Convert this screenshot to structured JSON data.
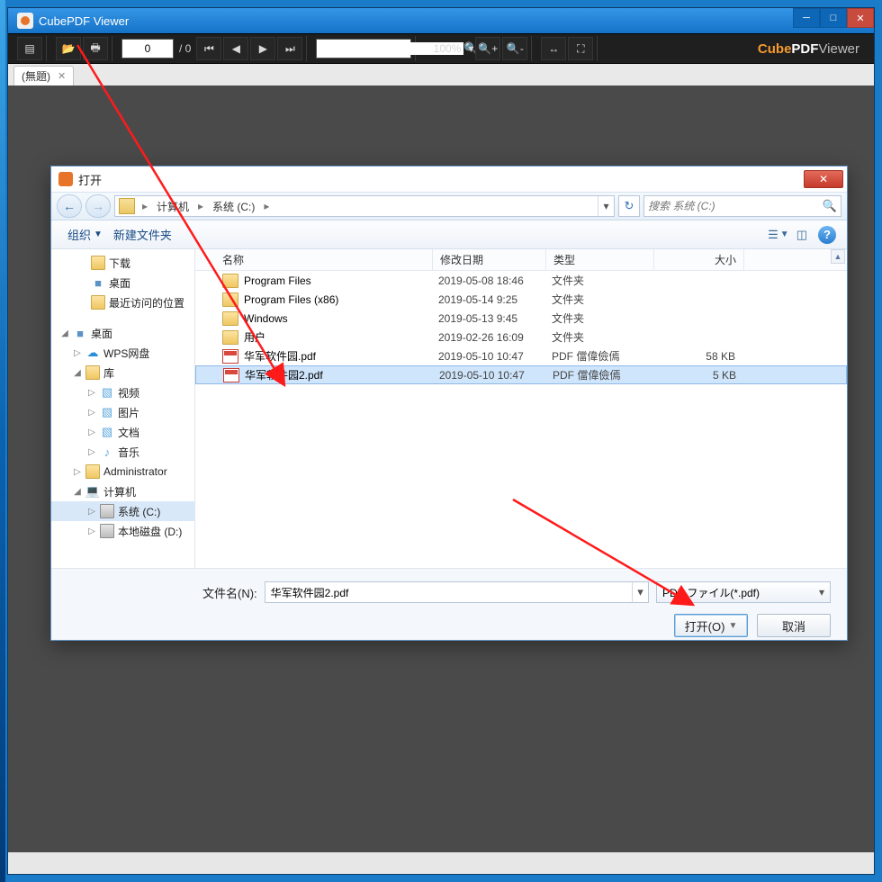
{
  "app": {
    "title": "CubePDF Viewer",
    "brand_parts": {
      "a": "Cube",
      "b": "PDF",
      "c": "Viewer"
    }
  },
  "toolbar": {
    "page_current": "0",
    "page_total": "/ 0",
    "zoom": "100%",
    "zoom_dd": "▾"
  },
  "tabs": {
    "untitled": "(無題)"
  },
  "dialog": {
    "title": "打开",
    "breadcrumb": {
      "seg1": "计算机",
      "seg2": "系统 (C:)"
    },
    "search_placeholder": "搜索 系统 (C:)",
    "toolbar": {
      "organize": "组织",
      "newfolder": "新建文件夹"
    },
    "headers": {
      "name": "名称",
      "date": "修改日期",
      "type": "类型",
      "size": "大小"
    },
    "filename_label": "文件名(N):",
    "filename_value": "华军软件园2.pdf",
    "filter": "PDF ファイル(*.pdf)",
    "open_btn": "打开(O)",
    "cancel_btn": "取消"
  },
  "sidebar": {
    "items": [
      {
        "label": "下载",
        "indent": 28,
        "twist": "",
        "ic": "ic-folder"
      },
      {
        "label": "桌面",
        "indent": 28,
        "twist": "",
        "ic": "ic-desktop",
        "glyph": "■"
      },
      {
        "label": "最近访问的位置",
        "indent": 28,
        "twist": "",
        "ic": "ic-folder"
      },
      {
        "label": "",
        "indent": 0,
        "twist": "",
        "ic": "",
        "spacer": true
      },
      {
        "label": "桌面",
        "indent": 8,
        "twist": "◢",
        "ic": "ic-desktop",
        "glyph": "■"
      },
      {
        "label": "WPS网盘",
        "indent": 22,
        "twist": "▷",
        "ic": "ic-wps",
        "glyph": "☁"
      },
      {
        "label": "库",
        "indent": 22,
        "twist": "◢",
        "ic": "ic-folder"
      },
      {
        "label": "视频",
        "indent": 38,
        "twist": "▷",
        "ic": "ic-lib",
        "glyph": "▧"
      },
      {
        "label": "图片",
        "indent": 38,
        "twist": "▷",
        "ic": "ic-lib",
        "glyph": "▧"
      },
      {
        "label": "文档",
        "indent": 38,
        "twist": "▷",
        "ic": "ic-lib",
        "glyph": "▧"
      },
      {
        "label": "音乐",
        "indent": 38,
        "twist": "▷",
        "ic": "ic-lib",
        "glyph": "♪"
      },
      {
        "label": "Administrator",
        "indent": 22,
        "twist": "▷",
        "ic": "ic-folder"
      },
      {
        "label": "计算机",
        "indent": 22,
        "twist": "◢",
        "ic": "ic-desktop",
        "glyph": "💻"
      },
      {
        "label": "系统 (C:)",
        "indent": 38,
        "twist": "▷",
        "ic": "ic-disk",
        "selected": true
      },
      {
        "label": "本地磁盘 (D:)",
        "indent": 38,
        "twist": "▷",
        "ic": "ic-disk"
      }
    ]
  },
  "files": [
    {
      "name": "Program Files",
      "date": "2019-05-08 18:46",
      "type": "文件夹",
      "size": "",
      "kind": "folder"
    },
    {
      "name": "Program Files (x86)",
      "date": "2019-05-14 9:25",
      "type": "文件夹",
      "size": "",
      "kind": "folder"
    },
    {
      "name": "Windows",
      "date": "2019-05-13 9:45",
      "type": "文件夹",
      "size": "",
      "kind": "folder"
    },
    {
      "name": "用户",
      "date": "2019-02-26 16:09",
      "type": "文件夹",
      "size": "",
      "kind": "folder"
    },
    {
      "name": "华军软件园.pdf",
      "date": "2019-05-10 10:47",
      "type": "PDF 儅偉儉傿",
      "size": "58 KB",
      "kind": "pdf"
    },
    {
      "name": "华军软件园2.pdf",
      "date": "2019-05-10 10:47",
      "type": "PDF 儅偉儉傿",
      "size": "5 KB",
      "kind": "pdf",
      "selected": true
    }
  ]
}
